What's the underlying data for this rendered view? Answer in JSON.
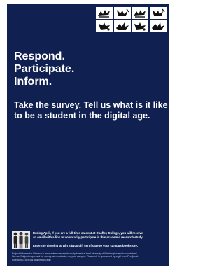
{
  "headline": {
    "lines": [
      "Respond.",
      "Participate.",
      "Inform."
    ]
  },
  "subhead": {
    "lines": [
      "Take the survey. Tell us what is it like",
      "to be a student in the digital age."
    ]
  },
  "notice": {
    "lines": [
      "During April, if you are a full-time student at Chaffey College, you will receive",
      "an email with a link to voluntarily participate in this academic research study."
    ]
  },
  "drawing": {
    "text": "Enter the drawing to win a $100 gift certificate to your campus bookstore."
  },
  "footer": {
    "lines": [
      "Project Information Literacy is an academic research study based at the University of Washington and has obtained",
      "Human Subjects Approval for survey administration on your campus. Research is sponsored by a gift from ProQuest.",
      "Questions? pil@uw.washington.edu"
    ]
  },
  "colors": {
    "poster_background": "#102050",
    "text": "#ffffff"
  },
  "icons": {
    "logo": "hand-gesture-icons",
    "people": "people-silhouette-icon"
  }
}
